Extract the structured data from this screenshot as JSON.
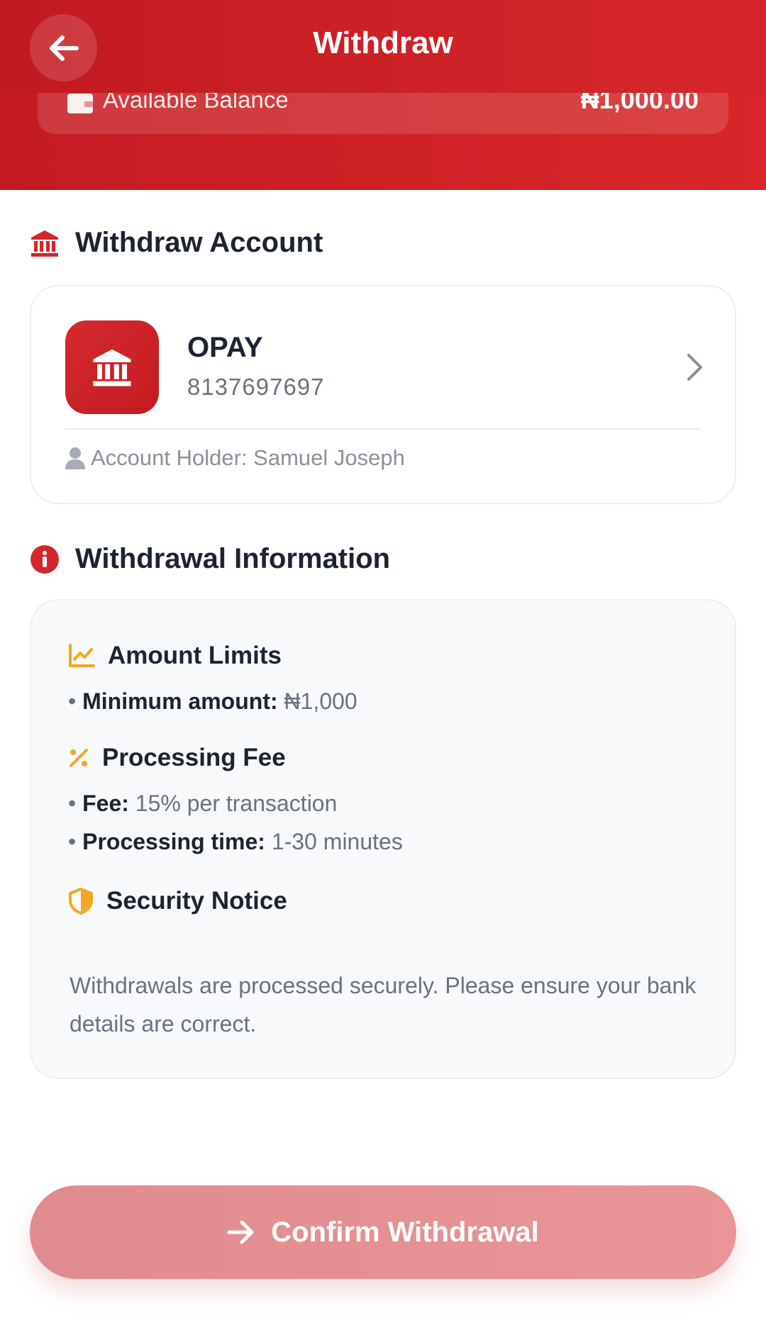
{
  "header": {
    "title": "Withdraw",
    "balance_label": "Available Balance",
    "balance_value": "₦1,000.00"
  },
  "account_section": {
    "title": "Withdraw Account",
    "bank_name": "OPAY",
    "account_number": "8137697697",
    "holder_text": "Account Holder: Samuel Joseph"
  },
  "info_section": {
    "title": "Withdrawal Information",
    "amount_limits": {
      "title": "Amount Limits",
      "min_label": "Minimum amount:",
      "min_value": "₦1,000"
    },
    "processing_fee": {
      "title": "Processing Fee",
      "fee_label": "Fee:",
      "fee_value": "15% per transaction",
      "time_label": "Processing time:",
      "time_value": "1-30 minutes"
    },
    "security": {
      "title": "Security Notice",
      "text": "Withdrawals are processed securely. Please ensure your bank details are correct."
    }
  },
  "confirm_button": {
    "label": "Confirm Withdrawal"
  },
  "colors": {
    "brand_red": "#cf2227",
    "accent_orange": "#f5a623",
    "button_disabled": "#e68f92"
  },
  "icons": [
    "arrow-left-icon",
    "wallet-icon",
    "bank-icon",
    "chevron-right-icon",
    "user-icon",
    "info-icon",
    "chart-line-icon",
    "percent-icon",
    "shield-icon",
    "arrow-right-icon"
  ]
}
